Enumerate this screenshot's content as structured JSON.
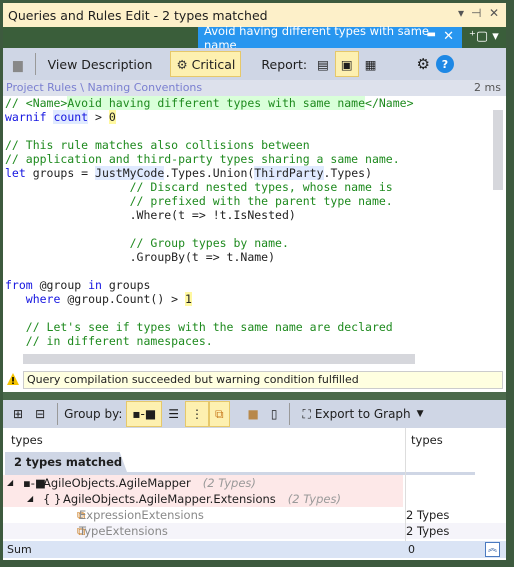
{
  "window": {
    "title": "Queries and Rules Edit  - 2 types matched",
    "tab": "Avoid having different types with same name"
  },
  "toolbar": {
    "view_description": "View Description",
    "critical": "Critical",
    "report": "Report:"
  },
  "breadcrumb": {
    "path": "Project Rules \\ Naming Conventions",
    "time": "2 ms"
  },
  "code": [
    [
      [
        "// <Name>",
        "c"
      ],
      [
        "Avoid having different types with same name",
        "c g"
      ],
      [
        "</Name>",
        "c"
      ]
    ],
    [
      [
        "warnif",
        "k"
      ],
      [
        " ",
        "t"
      ],
      [
        "count",
        "k h"
      ],
      [
        " > ",
        "t"
      ],
      [
        "0",
        "t n"
      ]
    ],
    [],
    [
      [
        "// This rule matches also collisions between",
        "c"
      ]
    ],
    [
      [
        "// application and third-party types sharing a same name.",
        "c"
      ]
    ],
    [
      [
        "let",
        "k"
      ],
      [
        " groups = ",
        "t"
      ],
      [
        "JustMyCode",
        "t h"
      ],
      [
        ".Types.Union(",
        "t"
      ],
      [
        "ThirdParty",
        "t h"
      ],
      [
        ".Types)",
        "t"
      ]
    ],
    [
      [
        "                  // Discard nested types, whose name is",
        "c"
      ]
    ],
    [
      [
        "                  // prefixed with the parent type name.",
        "c"
      ]
    ],
    [
      [
        "                  .Where(t => !t.IsNested)",
        "t"
      ]
    ],
    [],
    [
      [
        "                  // Group types by name.",
        "c"
      ]
    ],
    [
      [
        "                  .GroupBy(t => t.Name)",
        "t"
      ]
    ],
    [],
    [
      [
        "from",
        "k"
      ],
      [
        " @group ",
        "t"
      ],
      [
        "in",
        "k"
      ],
      [
        " groups",
        "t"
      ]
    ],
    [
      [
        "   ",
        "t"
      ],
      [
        "where",
        "k"
      ],
      [
        " @group.Count() > ",
        "t"
      ],
      [
        "1",
        "t n"
      ]
    ],
    [],
    [
      [
        "   // Let's see if types with the same name are declared",
        "c"
      ]
    ],
    [
      [
        "   // in different namespaces.",
        "c"
      ]
    ]
  ],
  "status": {
    "message": "Query compilation succeeded but warning condition fulfilled"
  },
  "results_toolbar": {
    "group_by": "Group by:",
    "export": "Export to Graph"
  },
  "results": {
    "headers": [
      "types",
      "types"
    ],
    "matched_tab": "2 types matched",
    "rows": [
      {
        "name": "AgileObjects.AgileMapper",
        "count": "(2 Types)",
        "value": "",
        "kind": "assembly"
      },
      {
        "name": "AgileObjects.AgileMapper.Extensions",
        "count": "(2 Types)",
        "value": "",
        "kind": "namespace"
      },
      {
        "name": "ExpressionExtensions",
        "count": "",
        "value": "2 Types",
        "kind": "type"
      },
      {
        "name": "TypeExtensions",
        "count": "",
        "value": "2 Types",
        "kind": "type"
      }
    ],
    "sum_label": "Sum",
    "sum_value": "0"
  },
  "colors": {
    "title_bg": "#fdf0c9",
    "tab_active": "#2896ef",
    "toolbar_bg": "#cfd6e5",
    "highlight_row": "#fde8e8",
    "comment": "#1e8a1e",
    "keyword": "#1515e0"
  }
}
